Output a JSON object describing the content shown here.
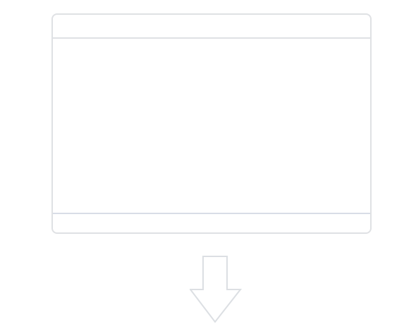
{
  "window": {
    "title": "",
    "status": ""
  },
  "icons": {
    "arrow": "arrow-down-icon"
  },
  "colors": {
    "border": "#dfe1e4",
    "footer_divider": "#d8dde6",
    "arrow_stroke": "#dcdfe3",
    "background": "#ffffff"
  }
}
